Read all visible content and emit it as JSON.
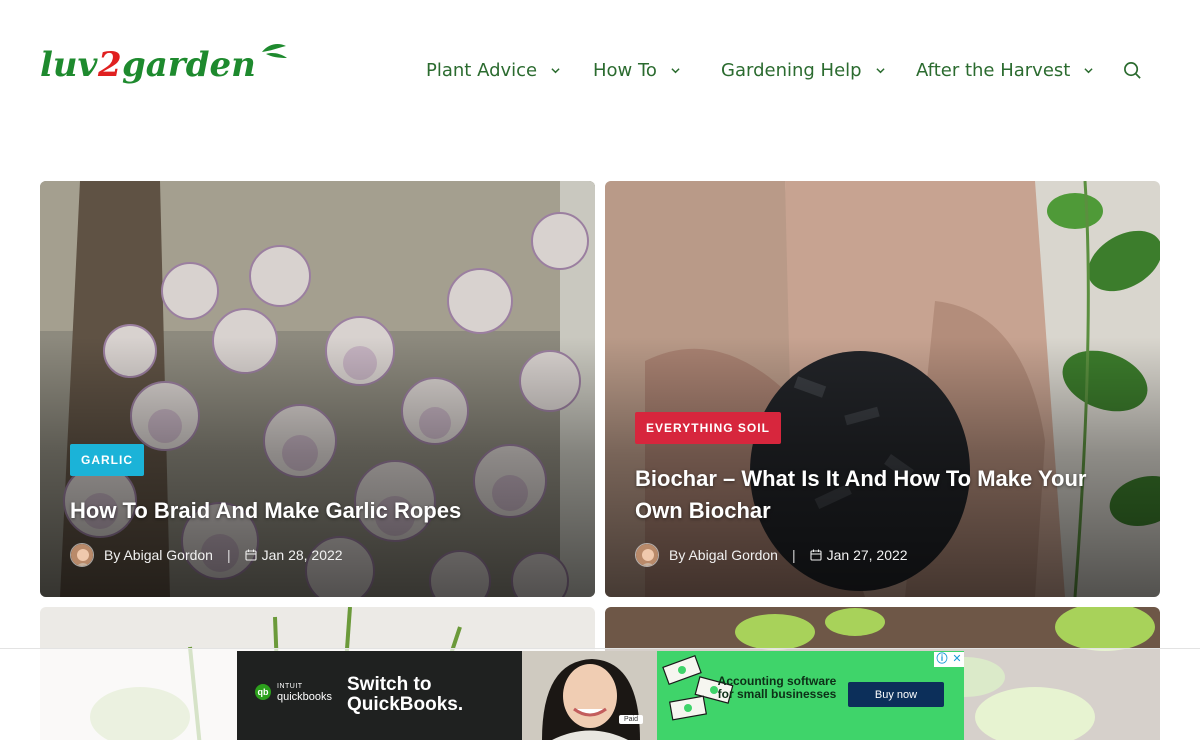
{
  "logo": {
    "text_a": "luv",
    "text_b": "2",
    "text_c": "garden"
  },
  "nav": {
    "items": [
      {
        "label": "Plant Advice"
      },
      {
        "label": "How To"
      },
      {
        "label": "Gardening Help"
      },
      {
        "label": "After the Harvest"
      }
    ]
  },
  "posts": [
    {
      "category": "GARLIC",
      "title": "How To Braid And Make Garlic Ropes",
      "author": "By Abigal Gordon",
      "separator": "|",
      "date": "Jan 28, 2022"
    },
    {
      "category": "EVERYTHING SOIL",
      "title": "Biochar – What Is It And How To Make Your Own Biochar",
      "author": "By Abigal Gordon",
      "separator": "|",
      "date": "Jan 27, 2022"
    }
  ],
  "ad": {
    "brand_small": "INTUIT",
    "brand": "quickbooks",
    "headline": "Switch to QuickBooks.",
    "copy": "Accounting software for small businesses",
    "cta": "Buy now",
    "chip": "Paid"
  },
  "colors": {
    "nav_text": "#2b6b2f",
    "logo_green": "#1e8a2e",
    "logo_red": "#e02020",
    "badge_garlic": "#1bb3d8",
    "badge_soil": "#d7263d"
  }
}
